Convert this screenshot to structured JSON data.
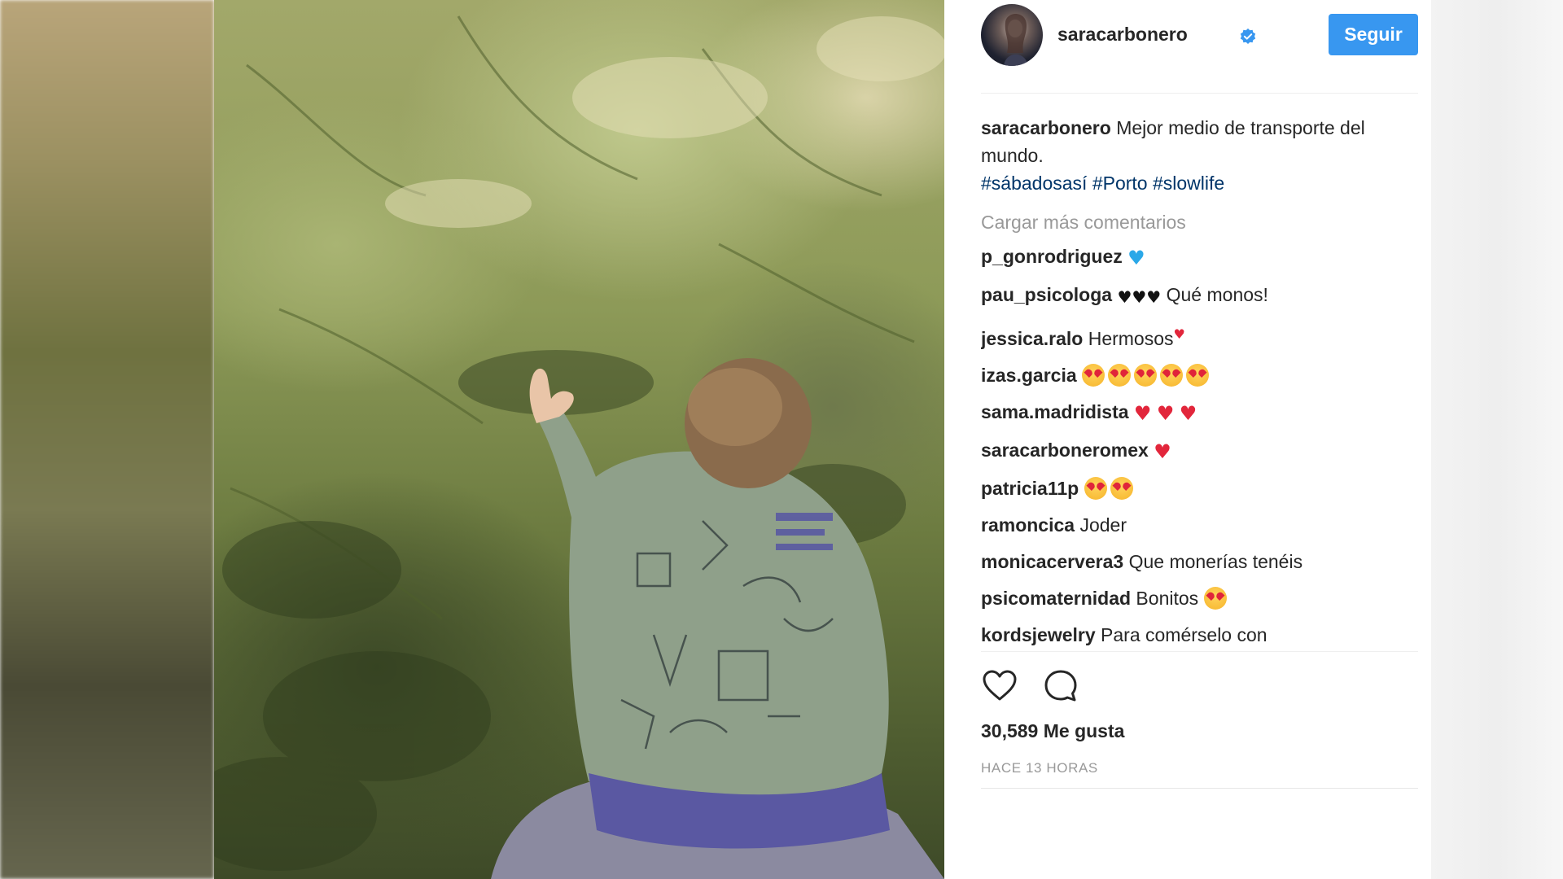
{
  "header": {
    "username": "saracarbonero",
    "follow_label": "Seguir"
  },
  "caption": {
    "username": "saracarbonero",
    "text": " Mejor medio de transporte del mundo.",
    "hashtags": [
      "#sábadosasí",
      "#Porto",
      "#slowlife"
    ]
  },
  "load_more_label": "Cargar más comentarios",
  "comments": [
    {
      "username": "p_gonrodriguez",
      "text": " "
    },
    {
      "username": "pau_psicologa",
      "text": " Qué monos!"
    },
    {
      "username": "jessica.ralo",
      "text": " Hermosos"
    },
    {
      "username": "izas.garcia",
      "text": " "
    },
    {
      "username": "sama.madridista",
      "text": " "
    },
    {
      "username": "saracarboneromex",
      "text": " "
    },
    {
      "username": "patricia11p",
      "text": " "
    },
    {
      "username": "ramoncica",
      "text": " Joder"
    },
    {
      "username": "monicacervera3",
      "text": " Que monerías tenéis"
    },
    {
      "username": "psicomaternidad",
      "text": " Bonitos "
    },
    {
      "username": "kordsjewelry",
      "text": " Para comérselo con"
    }
  ],
  "likes_label": "30,589 Me gusta",
  "timestamp": "HACE 13 HORAS",
  "icons": {
    "verified": "verified-badge-icon",
    "like": "heart-outline-icon",
    "comment": "comment-bubble-icon"
  },
  "colors": {
    "accent": "#3897f0",
    "hashtag": "#003569",
    "muted": "#999999",
    "text": "#262626"
  }
}
